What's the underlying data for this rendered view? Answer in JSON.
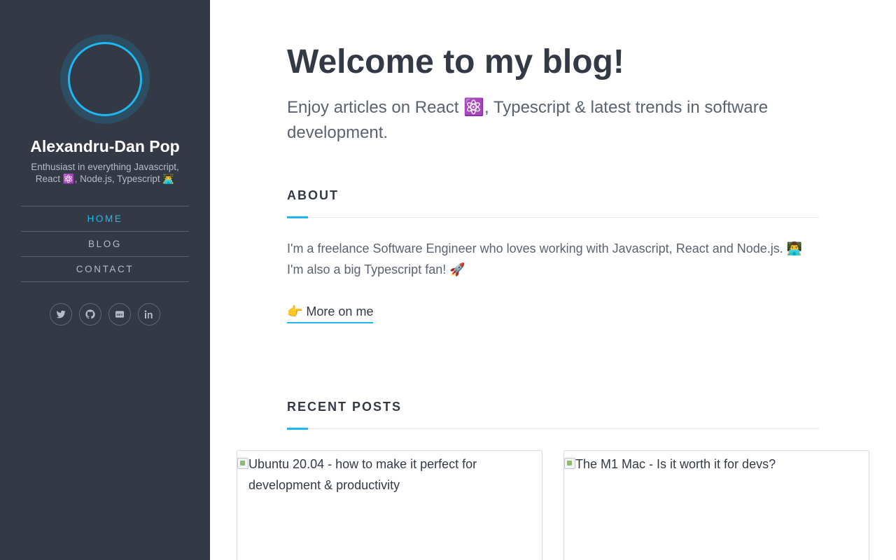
{
  "sidebar": {
    "author_name": "Alexandru-Dan Pop",
    "tagline": "Enthusiast in everything Javascript, React ⚛️, Node.js, Typescript 👨‍💻",
    "nav": [
      {
        "label": "Home",
        "active": true
      },
      {
        "label": "Blog",
        "active": false
      },
      {
        "label": "Contact",
        "active": false
      }
    ],
    "socials": [
      {
        "name": "twitter-icon"
      },
      {
        "name": "github-icon"
      },
      {
        "name": "dev-icon"
      },
      {
        "name": "linkedin-icon"
      }
    ]
  },
  "main": {
    "title": "Welcome to my blog!",
    "subtitle": "Enjoy articles on React ⚛️, Typescript & latest trends in software development.",
    "about": {
      "heading": "About",
      "text": "I'm a freelance Software Engineer who loves working with Javascript, React and Node.js. 👨‍💻 I'm also a big Typescript fan! 🚀",
      "more_link": "👉 More on me"
    },
    "recent_posts": {
      "heading": "Recent Posts",
      "posts": [
        {
          "image_alt": "Ubuntu 20.04 - how to make it perfect for development & productivity"
        },
        {
          "image_alt": "The M1 Mac - Is it worth it for devs?"
        }
      ]
    }
  },
  "colors": {
    "sidebar_bg": "#343a45",
    "accent": "#1eb8f0",
    "heading": "#343a45",
    "body_text": "#5b6270"
  }
}
